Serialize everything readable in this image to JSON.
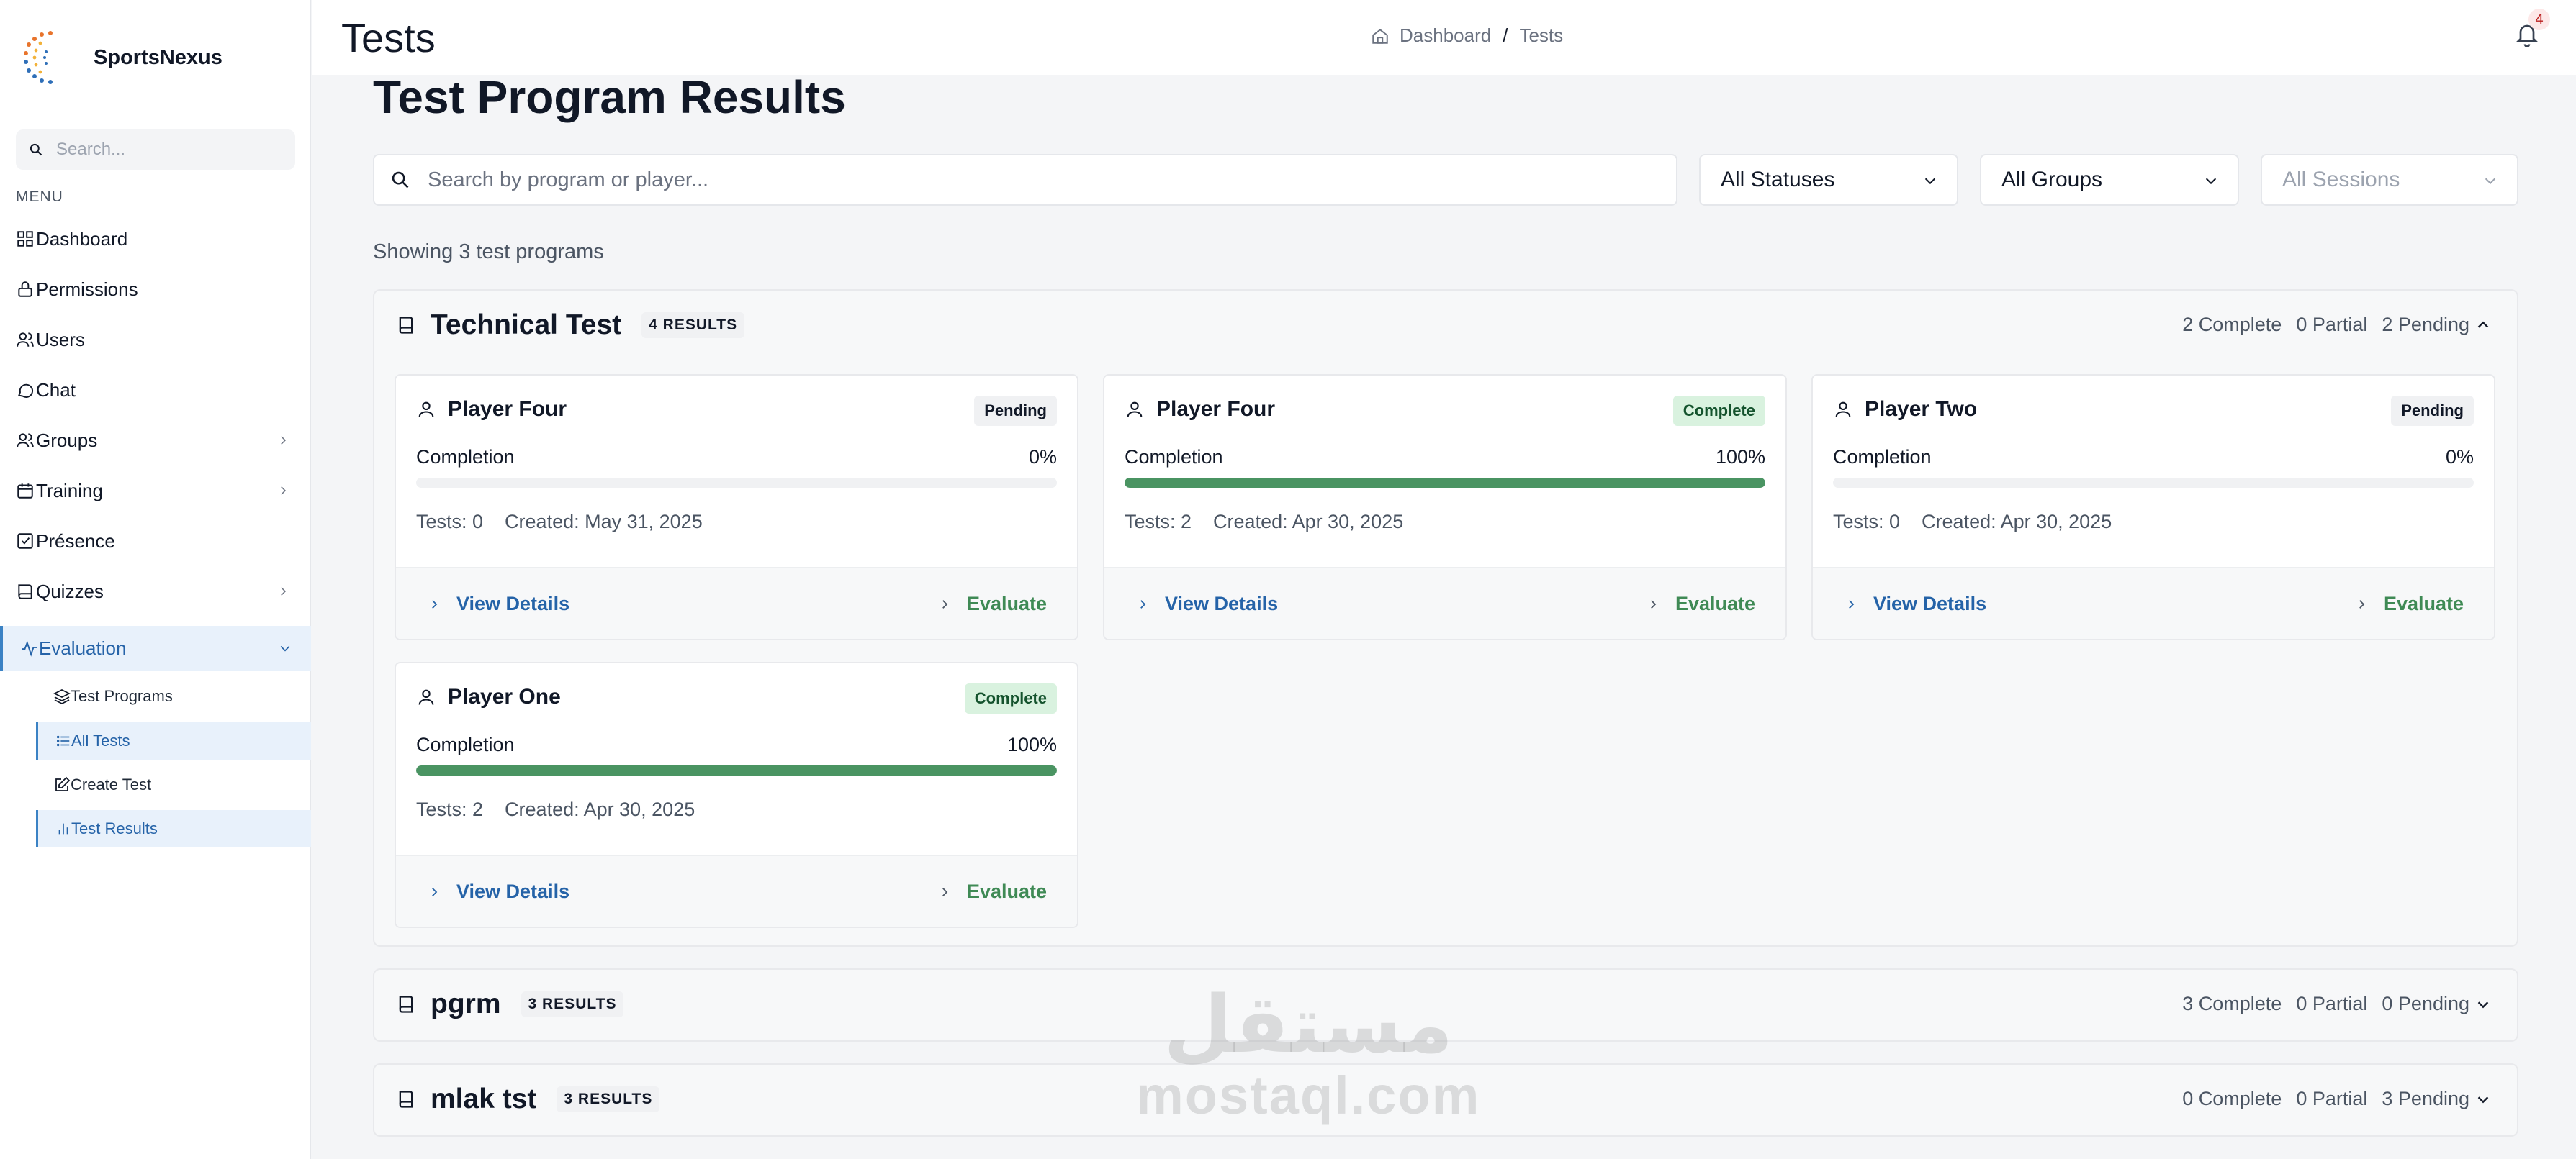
{
  "brand": {
    "name": "SportsNexus"
  },
  "sidebar": {
    "search_placeholder": "Search...",
    "menu_label": "MENU",
    "items": [
      {
        "label": "Dashboard",
        "icon": "grid-icon"
      },
      {
        "label": "Permissions",
        "icon": "lock-icon"
      },
      {
        "label": "Users",
        "icon": "users-icon"
      },
      {
        "label": "Chat",
        "icon": "chat-icon"
      },
      {
        "label": "Groups",
        "icon": "users-icon"
      },
      {
        "label": "Training",
        "icon": "calendar-icon"
      },
      {
        "label": "Présence",
        "icon": "check-square-icon"
      },
      {
        "label": "Quizzes",
        "icon": "book-icon"
      }
    ],
    "active": {
      "label": "Evaluation",
      "icon": "activity-icon"
    },
    "sub_items": [
      {
        "label": "Test Programs",
        "icon": "layers-icon"
      },
      {
        "label": "All Tests",
        "icon": "list-icon"
      },
      {
        "label": "Create Test",
        "icon": "edit-icon"
      },
      {
        "label": "Test Results",
        "icon": "bar-chart-icon"
      }
    ]
  },
  "header": {
    "title": "Tests",
    "breadcrumb": {
      "home": "Dashboard",
      "separator": "/",
      "current": "Tests"
    },
    "notifications": "4"
  },
  "main": {
    "title": "Test Program Results",
    "search_placeholder": "Search by program or player...",
    "filters": {
      "status": "All Statuses",
      "group": "All Groups",
      "session": "All Sessions"
    },
    "showing": "Showing 3 test programs"
  },
  "programs": [
    {
      "name": "Technical Test",
      "badge": "4 RESULTS",
      "complete": "2 Complete",
      "partial": "0 Partial",
      "pending": "2 Pending",
      "cards": [
        {
          "player": "Player Four",
          "status": "Pending",
          "completion_label": "Completion",
          "completion": "0%",
          "tests": "Tests: 0",
          "created": "Created: May 31, 2025",
          "view": "View Details",
          "evaluate": "Evaluate"
        },
        {
          "player": "Player Four",
          "status": "Complete",
          "completion_label": "Completion",
          "completion": "100%",
          "tests": "Tests: 2",
          "created": "Created: Apr 30, 2025",
          "view": "View Details",
          "evaluate": "Evaluate"
        },
        {
          "player": "Player Two",
          "status": "Pending",
          "completion_label": "Completion",
          "completion": "0%",
          "tests": "Tests: 0",
          "created": "Created: Apr 30, 2025",
          "view": "View Details",
          "evaluate": "Evaluate"
        },
        {
          "player": "Player One",
          "status": "Complete",
          "completion_label": "Completion",
          "completion": "100%",
          "tests": "Tests: 2",
          "created": "Created: Apr 30, 2025",
          "view": "View Details",
          "evaluate": "Evaluate"
        }
      ]
    },
    {
      "name": "pgrm",
      "badge": "3 RESULTS",
      "complete": "3 Complete",
      "partial": "0 Partial",
      "pending": "0 Pending"
    },
    {
      "name": "mlak tst",
      "badge": "3 RESULTS",
      "complete": "0 Complete",
      "partial": "0 Partial",
      "pending": "3 Pending"
    }
  ],
  "watermark": {
    "arabic": "مستقل",
    "latin": "mostaql.com"
  },
  "colors": {
    "accent": "#2563a8",
    "success": "#4a9462",
    "active_bg": "#e8f1fb"
  }
}
